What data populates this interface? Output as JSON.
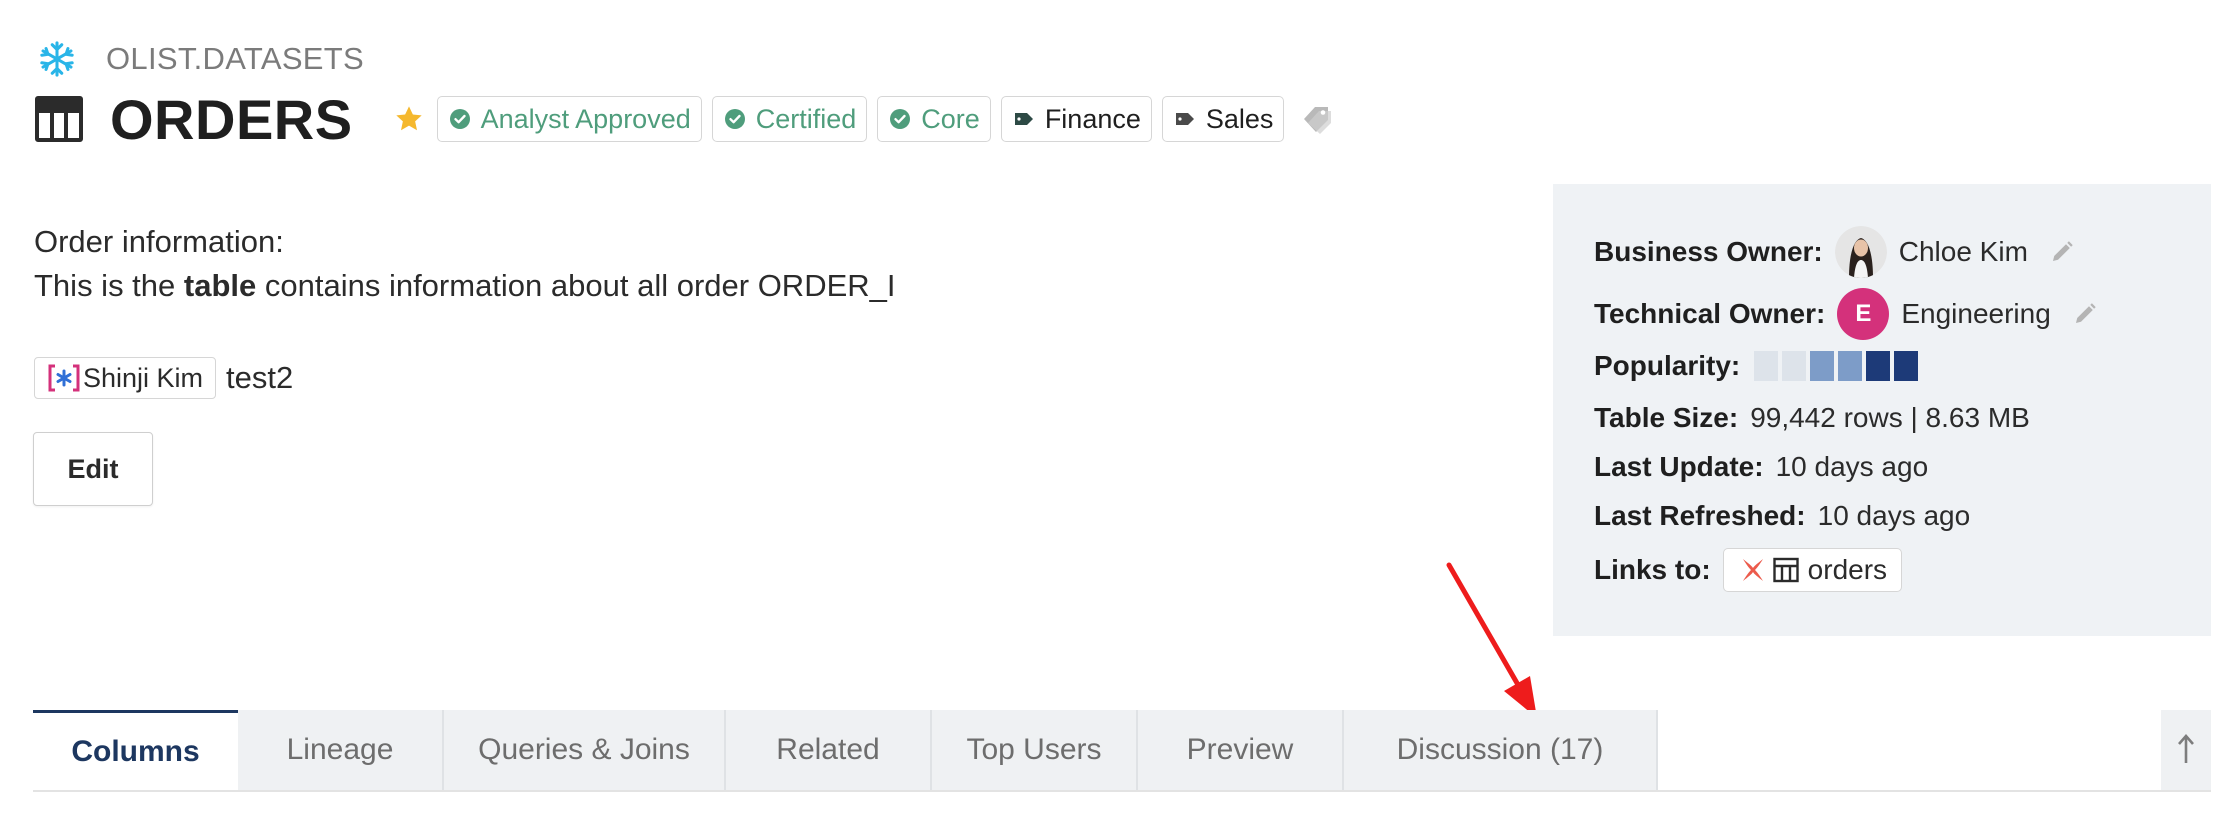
{
  "breadcrumb": {
    "icon": "snowflake-icon",
    "text": "OLIST.DATASETS"
  },
  "header": {
    "title": "ORDERS",
    "title_icon": "table-icon",
    "favorite_icon": "star-icon",
    "tags": [
      {
        "label": "Analyst Approved",
        "icon": "check-circle-icon",
        "style": "green"
      },
      {
        "label": "Certified",
        "icon": "check-circle-icon",
        "style": "green"
      },
      {
        "label": "Core",
        "icon": "check-circle-icon",
        "style": "green"
      },
      {
        "label": "Finance",
        "icon": "tag-icon",
        "style": "dark"
      },
      {
        "label": "Sales",
        "icon": "tag-icon",
        "style": "dark"
      }
    ],
    "add_tag_icon": "add-tag-icon"
  },
  "description": {
    "line1": "Order information:",
    "line2_prefix": "This is the ",
    "line2_bold": "table",
    "line2_suffix": " contains information about all order ORDER_I",
    "mention_name": "Shinji Kim",
    "mention_after": "test2",
    "edit_label": "Edit"
  },
  "panel": {
    "business_owner_label": "Business Owner:",
    "business_owner_value": "Chloe Kim",
    "technical_owner_label": "Technical Owner:",
    "technical_owner_initial": "E",
    "technical_owner_value": "Engineering",
    "popularity_label": "Popularity:",
    "popularity_level": 4,
    "popularity_max": 6,
    "table_size_label": "Table Size:",
    "table_size_value": "99,442 rows | 8.63 MB",
    "last_update_label": "Last Update:",
    "last_update_value": "10 days ago",
    "last_refreshed_label": "Last Refreshed:",
    "last_refreshed_value": "10 days ago",
    "links_label": "Links to:",
    "links_value": "orders"
  },
  "tabs": [
    {
      "label": "Columns",
      "active": true
    },
    {
      "label": "Lineage",
      "active": false
    },
    {
      "label": "Queries & Joins",
      "active": false
    },
    {
      "label": "Related",
      "active": false
    },
    {
      "label": "Top Users",
      "active": false
    },
    {
      "label": "Preview",
      "active": false
    },
    {
      "label": "Discussion (17)",
      "active": false
    }
  ],
  "colors": {
    "accent_navy": "#1d3760",
    "tag_green": "#4f9d7c",
    "star_yellow": "#f5b82e",
    "avatar_pink": "#d4317b",
    "arrow_red": "#ee1c1c",
    "panel_bg": "#eff2f5"
  }
}
